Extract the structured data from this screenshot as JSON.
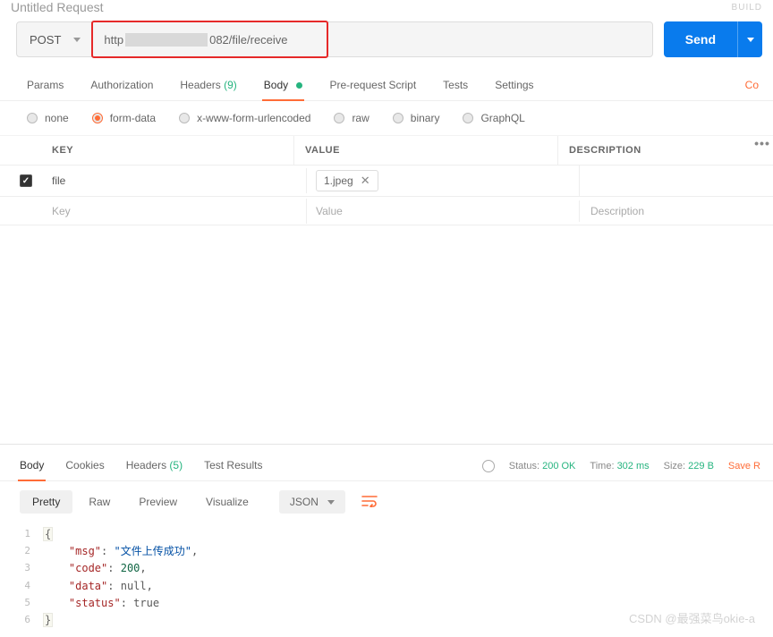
{
  "header": {
    "title": "Untitled Request",
    "build": "BUILD"
  },
  "request": {
    "method": "POST",
    "url_prefix": "http",
    "url_suffix": "082/file/receive",
    "send_label": "Send"
  },
  "tabs": {
    "params": "Params",
    "authorization": "Authorization",
    "headers": "Headers",
    "headers_count": "(9)",
    "body": "Body",
    "prerequest": "Pre-request Script",
    "tests": "Tests",
    "settings": "Settings",
    "cookies_link": "Co"
  },
  "body_types": {
    "none": "none",
    "formdata": "form-data",
    "urlencoded": "x-www-form-urlencoded",
    "raw": "raw",
    "binary": "binary",
    "graphql": "GraphQL"
  },
  "kv": {
    "key_header": "KEY",
    "value_header": "VALUE",
    "desc_header": "DESCRIPTION",
    "rows": [
      {
        "key": "file",
        "file_name": "1.jpeg",
        "checked": true
      }
    ],
    "key_placeholder": "Key",
    "value_placeholder": "Value",
    "desc_placeholder": "Description"
  },
  "response_tabs": {
    "body": "Body",
    "cookies": "Cookies",
    "headers": "Headers",
    "headers_count": "(5)",
    "test_results": "Test Results"
  },
  "status": {
    "status_label": "Status:",
    "status_value": "200 OK",
    "time_label": "Time:",
    "time_value": "302 ms",
    "size_label": "Size:",
    "size_value": "229 B",
    "save": "Save R"
  },
  "view": {
    "pretty": "Pretty",
    "raw": "Raw",
    "preview": "Preview",
    "visualize": "Visualize",
    "format": "JSON"
  },
  "response_json": {
    "line1": "{",
    "line2_key": "\"msg\"",
    "line2_val": "\"文件上传成功\"",
    "line3_key": "\"code\"",
    "line3_val": "200",
    "line4_key": "\"data\"",
    "line4_val": "null",
    "line5_key": "\"status\"",
    "line5_val": "true",
    "line6": "}"
  },
  "watermark": "CSDN @最强菜鸟okie-a"
}
